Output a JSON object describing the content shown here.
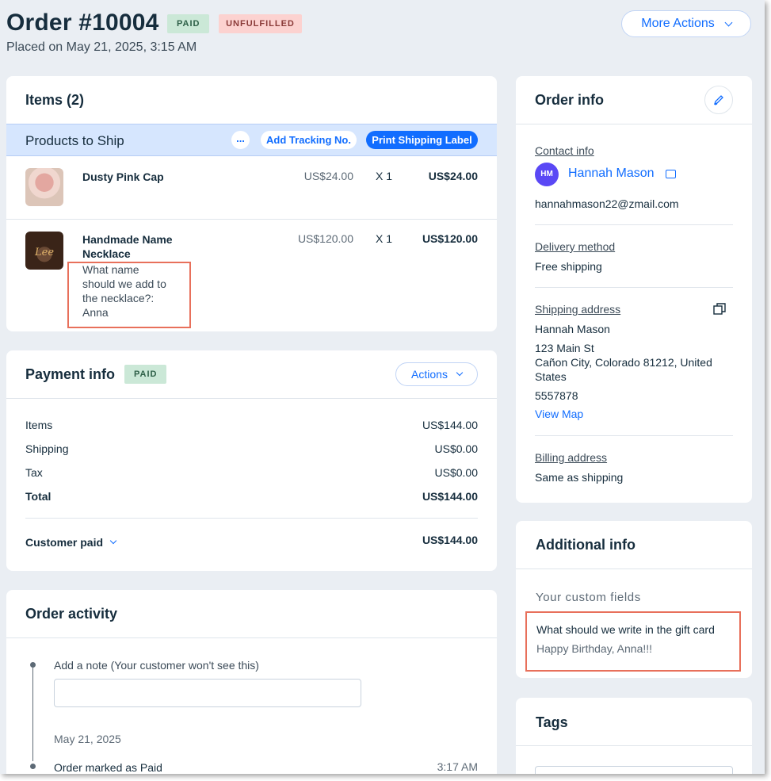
{
  "header": {
    "title": "Order #10004",
    "badge_paid": "PAID",
    "badge_unfulfilled": "UNFULFILLED",
    "placed_on": "Placed on May 21, 2025, 3:15 AM",
    "more_actions": "More Actions"
  },
  "items_card": {
    "title": "Items (2)",
    "bar_label": "Products to Ship",
    "more_icon": "...",
    "add_tracking": "Add Tracking No.",
    "print_label": "Print Shipping Label",
    "products": [
      {
        "name": "Dusty Pink Cap",
        "price": "US$24.00",
        "qty": "X 1",
        "total": "US$24.00"
      },
      {
        "name_line1": "Handmade Name",
        "name_line2": "Necklace",
        "price": "US$120.00",
        "qty": "X 1",
        "total": "US$120.00",
        "custom_lines": [
          "What name",
          "should we add to",
          "the necklace?:",
          "Anna"
        ],
        "thumb_text": "Lee"
      }
    ]
  },
  "payment_card": {
    "title": "Payment info",
    "badge": "PAID",
    "actions": "Actions",
    "rows": [
      {
        "label": "Items",
        "value": "US$144.00"
      },
      {
        "label": "Shipping",
        "value": "US$0.00"
      },
      {
        "label": "Tax",
        "value": "US$0.00"
      },
      {
        "label": "Total",
        "value": "US$144.00"
      }
    ],
    "customer_paid": "Customer paid",
    "customer_paid_value": "US$144.00"
  },
  "activity_card": {
    "title": "Order activity",
    "note_label": "Add a note (Your customer won't see this)",
    "date": "May 21, 2025",
    "event": "Order marked as Paid",
    "event_time": "3:17 AM"
  },
  "order_info": {
    "title": "Order info",
    "contact_label": "Contact info",
    "initials": "HM",
    "customer_name": "Hannah Mason",
    "email": "hannahmason22@zmail.com",
    "delivery_label": "Delivery method",
    "delivery_value": "Free shipping",
    "shipping_label": "Shipping address",
    "address_name": "Hannah Mason",
    "address_street": "123 Main St",
    "address_city_line1": "Cañon City, Colorado 81212, United",
    "address_city_line2": "States",
    "phone": "5557878",
    "view_map": "View Map",
    "billing_label": "Billing address",
    "billing_value": "Same as shipping"
  },
  "additional_info": {
    "title": "Additional info",
    "custom_fields_label": "Your custom fields",
    "field_label": "What should we write in  the gift card",
    "field_value": "Happy Birthday, Anna!!!"
  },
  "tags": {
    "title": "Tags"
  },
  "colors": {
    "accent": "#116dff",
    "highlight": "#e8705b",
    "background": "#eaeef3"
  }
}
